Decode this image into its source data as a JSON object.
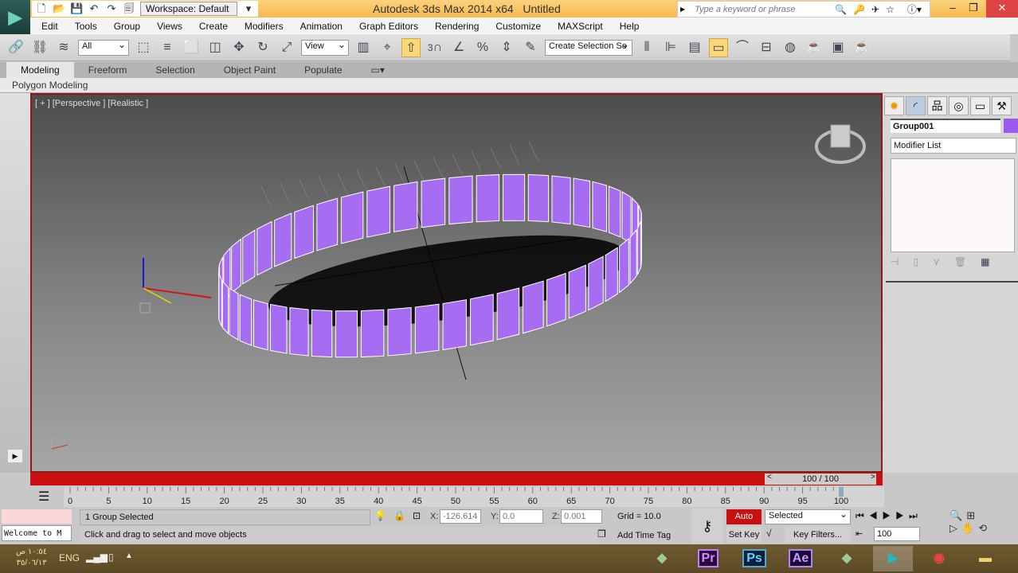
{
  "titlebar": {
    "title": "Autodesk 3ds Max  2014 x64",
    "document": "Untitled",
    "workspace": "Workspace: Default",
    "search_placeholder": "Type a keyword or phrase"
  },
  "menu": [
    "Edit",
    "Tools",
    "Group",
    "Views",
    "Create",
    "Modifiers",
    "Animation",
    "Graph Editors",
    "Rendering",
    "Customize",
    "MAXScript",
    "Help"
  ],
  "toolbar": {
    "selection_filter": "All",
    "ref_coord": "View",
    "selection_set": "Create Selection Se",
    "snap_angle": "3"
  },
  "ribbon": {
    "tabs": [
      "Modeling",
      "Freeform",
      "Selection",
      "Object Paint",
      "Populate"
    ],
    "active": "Modeling",
    "panel": "Polygon Modeling"
  },
  "viewport": {
    "label": "[ + ] [Perspective ] [Realistic ]",
    "object_color": "#a66cf2"
  },
  "command_panel": {
    "object_name": "Group001",
    "object_color": "#9a5af0",
    "modifier_list": "Modifier List"
  },
  "timeline": {
    "frame_indicator": "100 / 100",
    "ticks": [
      "0",
      "5",
      "10",
      "15",
      "20",
      "25",
      "30",
      "35",
      "40",
      "45",
      "50",
      "55",
      "60",
      "65",
      "70",
      "75",
      "80",
      "85",
      "90",
      "95",
      "100"
    ],
    "current_frame": 100
  },
  "status": {
    "selection": "1 Group Selected",
    "prompt": "Click and drag to select and move objects",
    "listener": "Welcome to M",
    "x_label": "X:",
    "x": "-126.614",
    "y_label": "Y:",
    "y": "0.0",
    "z_label": "Z:",
    "z": "0.001",
    "grid": "Grid = 10.0",
    "add_time_tag": "Add Time Tag",
    "auto_key": "Auto Key",
    "set_key": "Set Key",
    "key_mode": "Selected",
    "key_filters": "Key Filters...",
    "frame_field": "100"
  },
  "taskbar": {
    "time": "١٠:٥٤ ص",
    "date": "٣٥/٠٦/١٣",
    "lang": "ENG",
    "apps": [
      "Pr",
      "Ps",
      "Ae"
    ]
  }
}
